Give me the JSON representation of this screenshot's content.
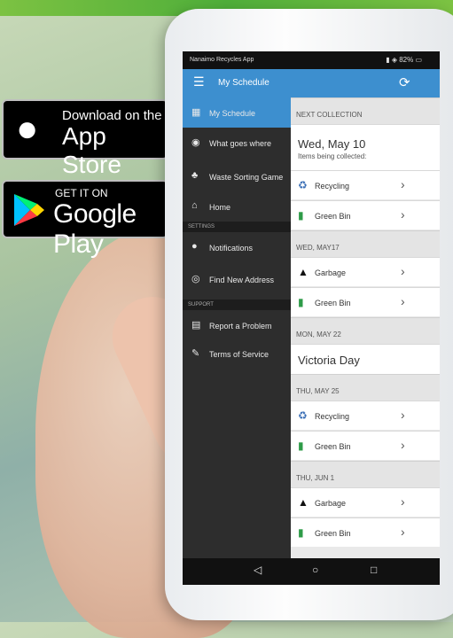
{
  "badges": {
    "apple": {
      "line1": "Download on the",
      "line2": "App Store"
    },
    "google": {
      "line1": "GET IT ON",
      "line2": "Google Play"
    }
  },
  "status": {
    "app_name": "Nanaimo Recycles App",
    "battery": "82%"
  },
  "appbar": {
    "title": "My Schedule",
    "menu_icon": "☰",
    "sync_icon": "⟳"
  },
  "drawer": {
    "items": [
      {
        "label": "My Schedule",
        "icon": "▦"
      },
      {
        "label": "What goes where",
        "icon": "◉"
      },
      {
        "label": "Waste Sorting Game",
        "icon": "♣"
      },
      {
        "label": "Home",
        "icon": "⌂"
      }
    ],
    "settings_header": "SETTINGS",
    "settings_items": [
      {
        "label": "Notifications",
        "icon": "●"
      },
      {
        "label": "Find New Address",
        "icon": "◎"
      }
    ],
    "support_header": "SUPPORT",
    "support_items": [
      {
        "label": "Report a Problem",
        "icon": "▤"
      },
      {
        "label": "Terms of Service",
        "icon": "✎"
      }
    ]
  },
  "schedule": {
    "next_header": "NEXT COLLECTION",
    "next_date": "Wed, May 10",
    "next_sub": "Items being collected:",
    "next_rows": [
      {
        "label": "Recycling",
        "icon": "♻",
        "color": "#3b6fb6"
      },
      {
        "label": "Green Bin",
        "icon": "▮",
        "color": "#2e9b48"
      }
    ],
    "group2_header": "WED, MAY17",
    "group2_rows": [
      {
        "label": "Garbage",
        "icon": "▲",
        "color": "#111111"
      },
      {
        "label": "Green Bin",
        "icon": "▮",
        "color": "#2e9b48"
      }
    ],
    "group3_header": "MON, MAY 22",
    "group3_title": "Victoria Day",
    "group4_header": "THU, MAY 25",
    "group4_rows": [
      {
        "label": "Recycling",
        "icon": "♻",
        "color": "#3b6fb6"
      },
      {
        "label": "Green Bin",
        "icon": "▮",
        "color": "#2e9b48"
      }
    ],
    "group5_header": "THU, JUN 1",
    "group5_rows": [
      {
        "label": "Garbage",
        "icon": "▲",
        "color": "#111111"
      },
      {
        "label": "Green Bin",
        "icon": "▮",
        "color": "#2e9b48"
      }
    ],
    "chevron": "›"
  },
  "navbar": {
    "back": "◁",
    "home": "○",
    "recent": "□"
  },
  "colors": {
    "accent": "#3d8fcf",
    "drawer_bg": "#2d2d2d",
    "brand_green": "#4fae3a"
  }
}
